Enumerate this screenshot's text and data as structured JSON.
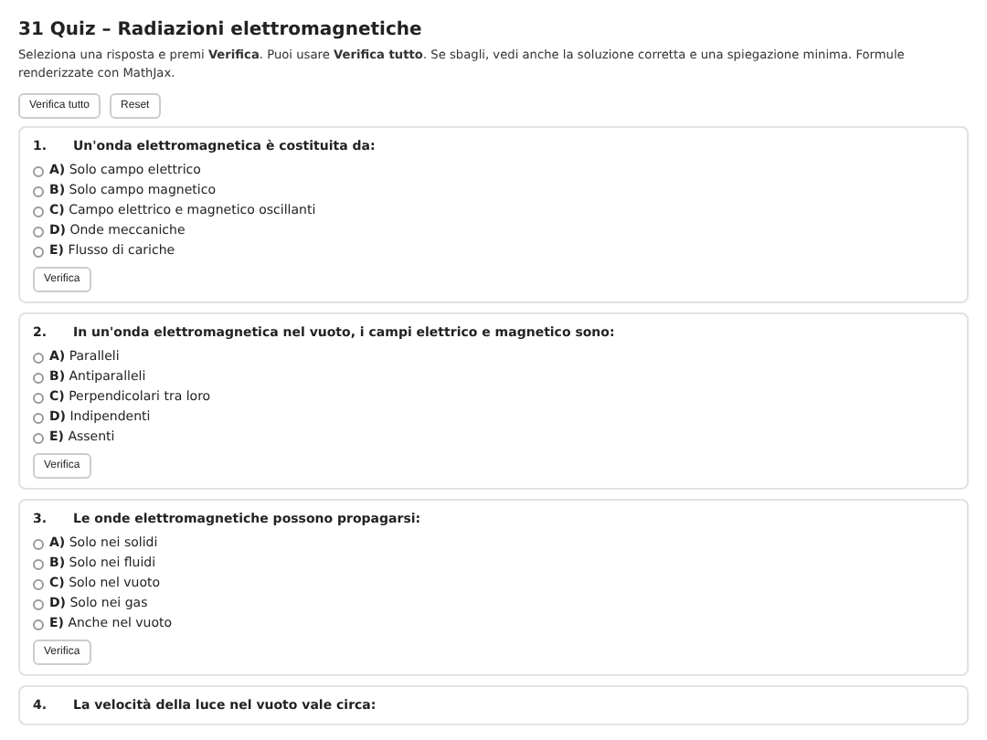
{
  "title": "31 Quiz – Radiazioni elettromagnetiche",
  "intro": "Seleziona una risposta e premi **Verifica**. Puoi usare **Verifica tutto**. Se sbagli, vedi anche la soluzione corretta e una spiegazione minima. Formule renderizzate con MathJax.",
  "toolbar": [
    "Verifica tutto",
    "Reset"
  ],
  "questions": [
    {
      "number": "1.",
      "text": "Un'onda elettromagnetica è costituita da:",
      "options": [
        {
          "label": "**A)** Solo campo elettrico",
          "selected": false
        },
        {
          "label": "**B)** Solo campo magnetico",
          "selected": false
        },
        {
          "label": "**C)** Campo elettrico e magnetico oscillanti",
          "selected": false
        },
        {
          "label": "**D)** Onde meccaniche",
          "selected": false
        },
        {
          "label": "**E)** Flusso di cariche",
          "selected": false
        }
      ],
      "button": "Verifica"
    },
    {
      "number": "2.",
      "text": "In un'onda elettromagnetica nel vuoto, i campi elettrico e magnetico sono:",
      "options": [
        {
          "label": "**A)** Paralleli",
          "selected": false
        },
        {
          "label": "**B)** Antiparalleli",
          "selected": false
        },
        {
          "label": "**C)** Perpendicolari tra loro",
          "selected": false
        },
        {
          "label": "**D)** Indipendenti",
          "selected": false
        },
        {
          "label": "**E)** Assenti",
          "selected": false
        }
      ],
      "button": "Verifica"
    },
    {
      "number": "3.",
      "text": "Le onde elettromagnetiche possono propagarsi:",
      "options": [
        {
          "label": "**A)** Solo nei solidi",
          "selected": false
        },
        {
          "label": "**B)** Solo nei fluidi",
          "selected": false
        },
        {
          "label": "**C)** Solo nel vuoto",
          "selected": false
        },
        {
          "label": "**D)** Solo nei gas",
          "selected": false
        },
        {
          "label": "**E)** Anche nel vuoto",
          "selected": false
        }
      ],
      "button": "Verifica"
    },
    {
      "number": "4.",
      "text": "La velocità della luce nel vuoto vale circa:"
    }
  ]
}
